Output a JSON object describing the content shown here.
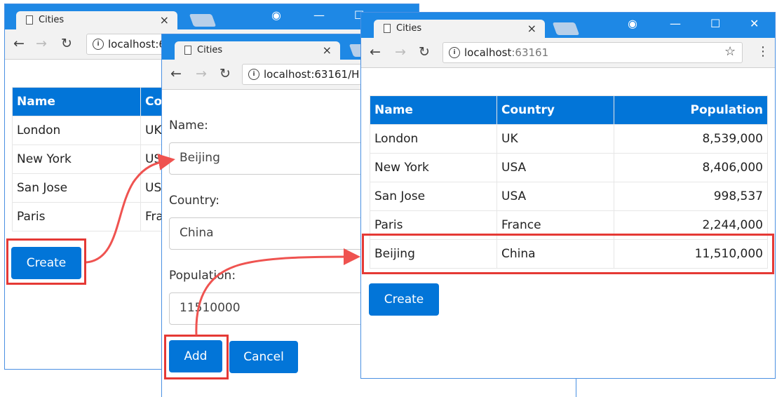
{
  "app": {
    "tab_title": "Cities",
    "url_host": "localhost",
    "url_port": ":63161",
    "url_host_form": "localhost:63161/H",
    "url_host_left": "localhost:6"
  },
  "table": {
    "headers": [
      "Name",
      "Country",
      "Population"
    ],
    "rows": [
      [
        "London",
        "UK",
        "8,539,000"
      ],
      [
        "New York",
        "USA",
        "8,406,000"
      ],
      [
        "San Jose",
        "USA",
        "998,537"
      ],
      [
        "Paris",
        "France",
        "2,244,000"
      ],
      [
        "Beijing",
        "China",
        "11,510,000"
      ]
    ]
  },
  "left_window": {
    "header_name": "Name",
    "header_country_clipped": "Co",
    "rows": [
      {
        "name": "London",
        "country": "UK"
      },
      {
        "name": "New York",
        "country": "US"
      },
      {
        "name": "San Jose",
        "country": "US"
      },
      {
        "name": "Paris",
        "country": "Fra"
      }
    ],
    "create_label": "Create"
  },
  "form": {
    "name_label": "Name:",
    "name_value": "Beijing",
    "country_label": "Country:",
    "country_value": "China",
    "population_label": "Population:",
    "population_value": "11510000",
    "add_label": "Add",
    "cancel_label": "Cancel"
  },
  "right_window": {
    "create_label": "Create"
  },
  "icons": {
    "back": "back-arrow-icon",
    "forward": "forward-arrow-icon",
    "reload": "reload-icon",
    "info": "info-icon",
    "star": "bookmark-star-icon",
    "menu": "kebab-menu-icon",
    "account": "account-icon",
    "minimize": "minimize-icon",
    "maximize": "maximize-icon",
    "close": "close-icon"
  },
  "colors": {
    "titlebar": "#1e88e5",
    "primary_button": "#0275d8",
    "highlight": "#e53935"
  }
}
